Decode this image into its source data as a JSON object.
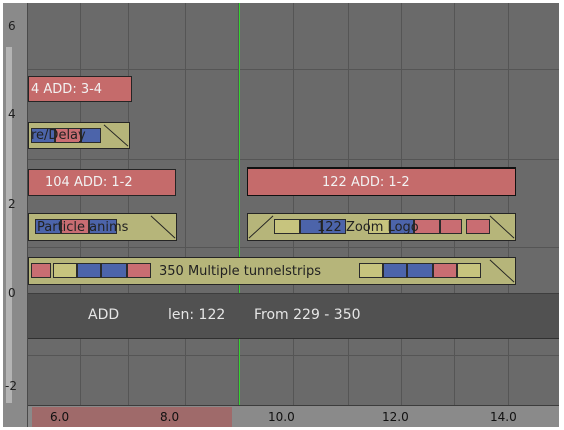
{
  "y_ruler": [
    "6",
    "4",
    "2",
    "0",
    "-2"
  ],
  "x_ruler": [
    "6.0",
    "8.0",
    "10.0",
    "12.0",
    "14.0"
  ],
  "strips": {
    "s1": "4 ADD: 3-4",
    "s2": "re/Delay",
    "s3": "104 ADD: 1-2",
    "s4": "Particle anims",
    "s5": "122 ADD: 1-2",
    "s6": "122 Zoom Logo",
    "s7": "350 Multiple tunnelstrips"
  },
  "info": {
    "type": "ADD",
    "len": "len: 122",
    "range": "From 229 - 350"
  },
  "colors": {
    "add_strip": "#c56b6b",
    "meta_strip": "#b6b57a",
    "frame_cursor": "#36d431",
    "slot_blue": "#4c64aa"
  }
}
